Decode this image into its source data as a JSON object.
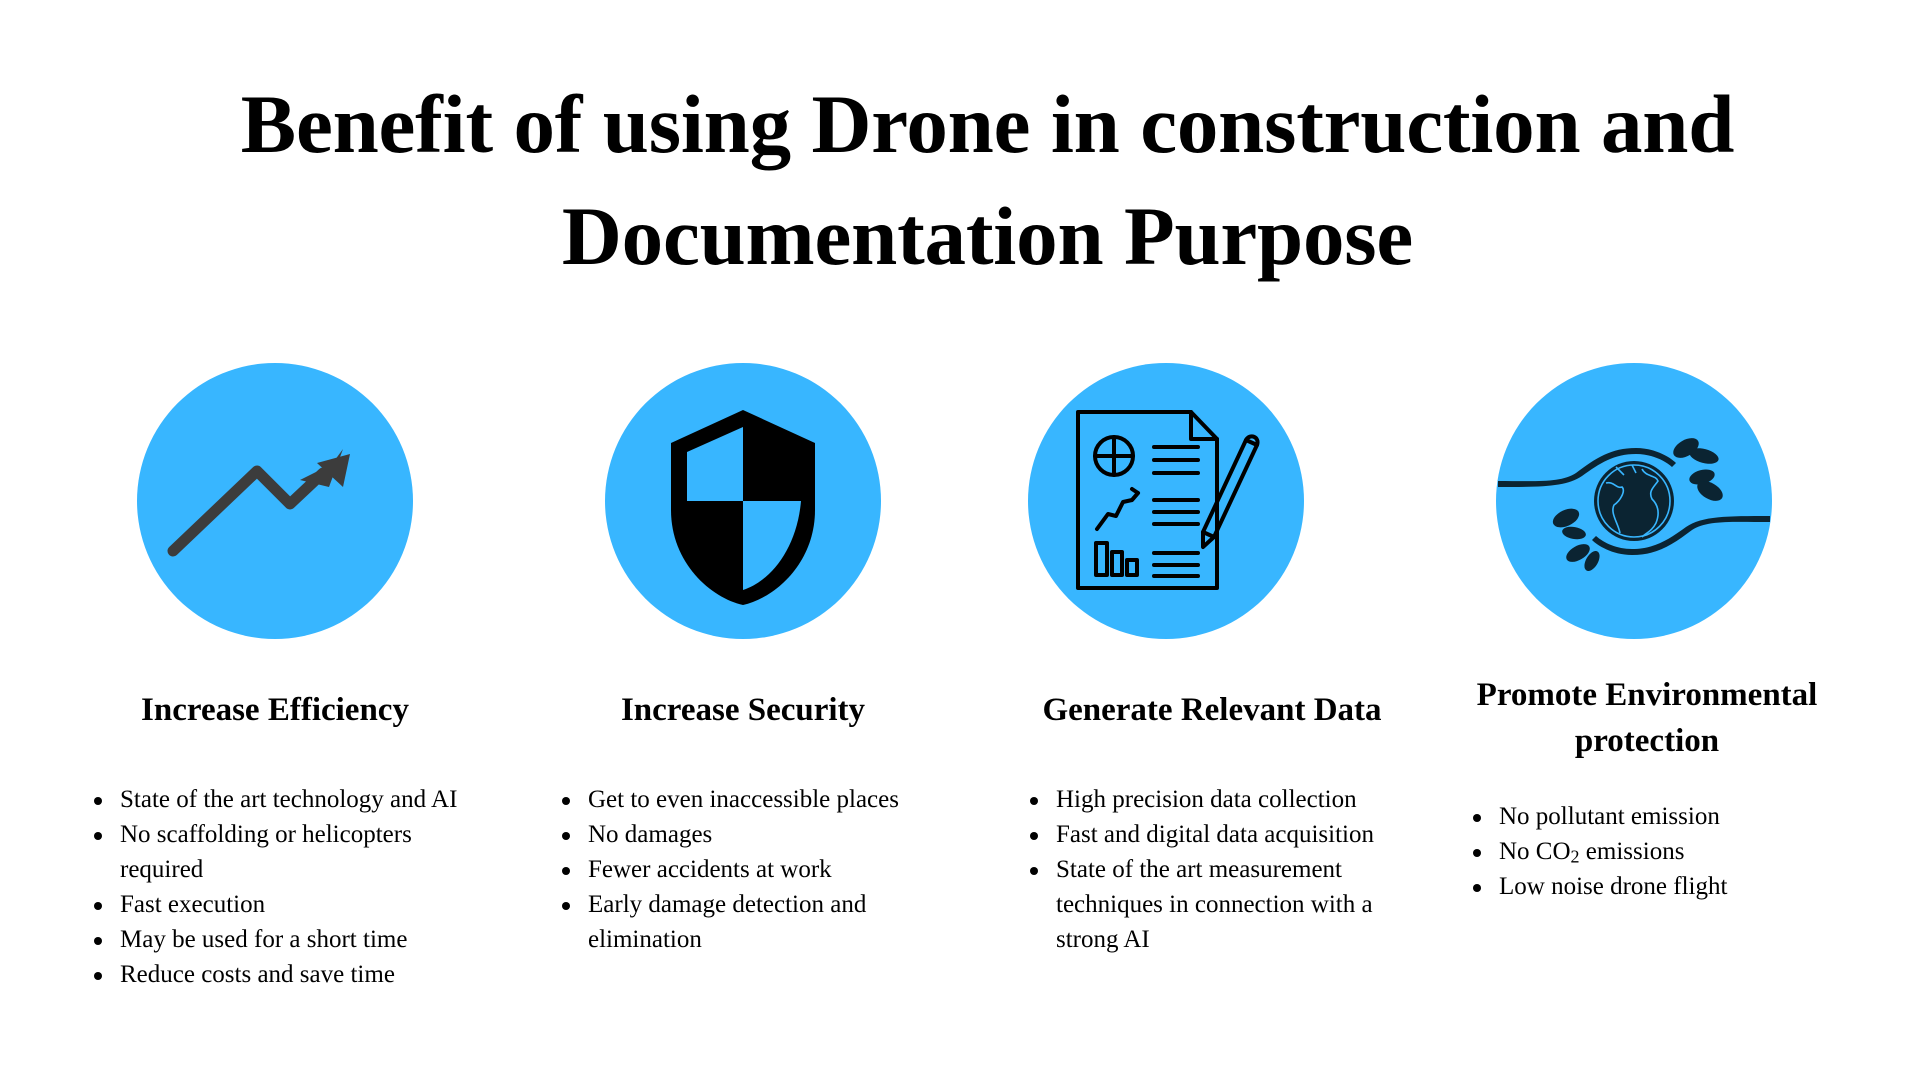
{
  "title": {
    "line1": "Benefit of using Drone in construction and",
    "line2": "Documentation Purpose"
  },
  "theme": {
    "circle_color": "#38B6FF",
    "icon_dark": "#3C3C3C",
    "icon_black": "#000000",
    "icon_navy": "#0B2432"
  },
  "benefits": [
    {
      "icon": "trending-up-arrow-icon",
      "heading": "Increase Efficiency",
      "items": [
        "State of the art technology and AI",
        "No scaffolding or helicopters required",
        "Fast execution",
        "May be used for a short time",
        "Reduce costs and save time"
      ]
    },
    {
      "icon": "shield-icon",
      "heading": "Increase Security",
      "items": [
        "Get to even inaccessible places",
        "No damages",
        "Fewer accidents at work",
        "Early damage detection and elimination"
      ]
    },
    {
      "icon": "report-document-pencil-icon",
      "heading": "Generate Relevant Data",
      "items": [
        "High precision data collection",
        "Fast and digital data acquisition",
        "State of the art measurement techniques in connection with a strong AI"
      ]
    },
    {
      "icon": "globe-hands-leaves-icon",
      "heading": "Promote Environmental protection",
      "items": [
        "No pollutant emission",
        "No CO",
        "Low noise drone flight"
      ],
      "co2_subscript": "2",
      "co2_suffix": " emissions"
    }
  ]
}
